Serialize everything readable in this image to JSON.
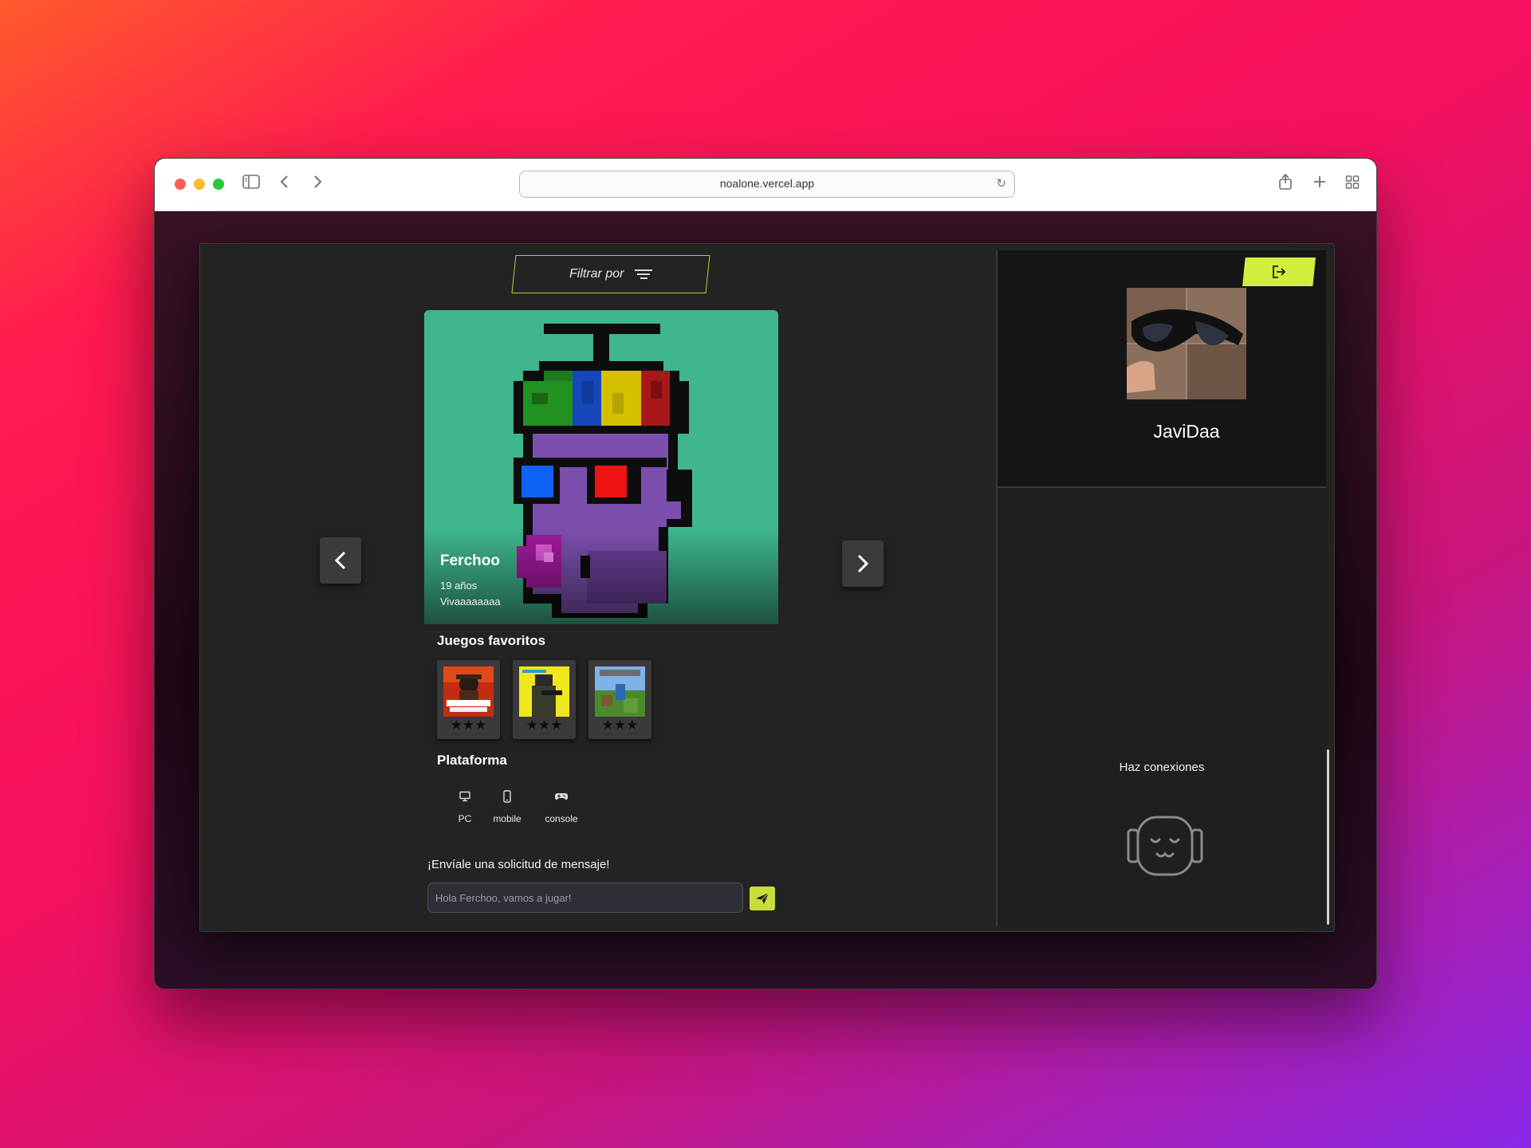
{
  "browser": {
    "url": "noalone.vercel.app"
  },
  "filter": {
    "label": "Filtrar por"
  },
  "profile": {
    "name": "Ferchoo",
    "age": "19 años",
    "bio": "Vivaaaaaaaa"
  },
  "favorites": {
    "title": "Juegos favoritos",
    "games": [
      {
        "name": "Red Dead Redemption II",
        "stars": "★★★",
        "rating": 3
      },
      {
        "name": "Cyberpunk 2077",
        "stars": "★★★",
        "rating": 3
      },
      {
        "name": "Minecraft",
        "stars": "★★★",
        "rating": 3
      }
    ]
  },
  "platform": {
    "title": "Plataforma",
    "items": [
      {
        "label": "PC",
        "icon": "monitor-icon"
      },
      {
        "label": "mobile",
        "icon": "mobile-icon"
      },
      {
        "label": "console",
        "icon": "gamepad-icon"
      }
    ]
  },
  "message": {
    "label": "¡Envíale una solicitud de mensaje!",
    "placeholder": "Hola Ferchoo, vamos a jugar!"
  },
  "user": {
    "name": "JaviDaa"
  },
  "connections": {
    "text": "Haz conexiones"
  },
  "colors": {
    "accent": "#d2ee3c",
    "card_bg": "#3fb68e",
    "app_bg": "#232323"
  }
}
